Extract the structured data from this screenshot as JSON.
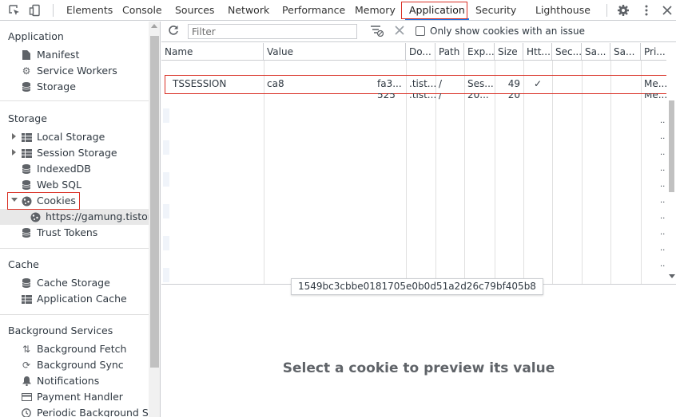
{
  "tabs": [
    "Elements",
    "Console",
    "Sources",
    "Network",
    "Performance",
    "Memory",
    "Application",
    "Security",
    "Lighthouse"
  ],
  "active_tab": "Application",
  "toolbar_icons": {
    "inspect": "inspect-icon",
    "device": "device-toggle-icon",
    "settings": "gear-icon",
    "more": "more-icon",
    "close": "close-icon"
  },
  "sidebar": {
    "application": {
      "title": "Application",
      "items": [
        {
          "label": "Manifest",
          "icon": "document-icon"
        },
        {
          "label": "Service Workers",
          "icon": "gear-icon"
        },
        {
          "label": "Storage",
          "icon": "database-icon"
        }
      ]
    },
    "storage": {
      "title": "Storage",
      "items": [
        {
          "label": "Local Storage",
          "icon": "grid-icon"
        },
        {
          "label": "Session Storage",
          "icon": "grid-icon"
        },
        {
          "label": "IndexedDB",
          "icon": "database-icon"
        },
        {
          "label": "Web SQL",
          "icon": "database-icon"
        },
        {
          "label": "Cookies",
          "icon": "cookie-icon"
        },
        {
          "label": "https://gamung.tistory.c",
          "icon": "cookie-icon"
        },
        {
          "label": "Trust Tokens",
          "icon": "database-icon"
        }
      ]
    },
    "cache": {
      "title": "Cache",
      "items": [
        {
          "label": "Cache Storage",
          "icon": "database-icon"
        },
        {
          "label": "Application Cache",
          "icon": "grid-icon"
        }
      ]
    },
    "background": {
      "title": "Background Services",
      "items": [
        {
          "label": "Background Fetch",
          "icon": "arrows-icon"
        },
        {
          "label": "Background Sync",
          "icon": "sync-icon"
        },
        {
          "label": "Notifications",
          "icon": "bell-icon"
        },
        {
          "label": "Payment Handler",
          "icon": "card-icon"
        },
        {
          "label": "Periodic Background Sync",
          "icon": "clock-icon"
        }
      ]
    }
  },
  "cookie_toolbar": {
    "filter_placeholder": "Filter",
    "only_issue_label": "Only show cookies with an issue"
  },
  "table": {
    "columns": [
      "Name",
      "Value",
      "Do...",
      "Path",
      "Exp...",
      "Size",
      "Htt...",
      "Sec...",
      "Sa...",
      "Sa...",
      "Pri..."
    ],
    "rows": [
      {
        "name": "TSSESSION",
        "value": "ca8",
        "value_tail": "fa3...",
        "domain": ".tist...",
        "path": "/",
        "expires": "Ses...",
        "size": "49",
        "httponly": "✓",
        "secure": "",
        "samesite": "",
        "sameparty": "",
        "priority": "Me..."
      },
      {
        "name": "",
        "value": "",
        "value_tail": "525",
        "domain": ".tist...",
        "path": "/",
        "expires": "20...",
        "size": "20",
        "httponly": "",
        "secure": "",
        "samesite": "",
        "sameparty": "",
        "priority": "Me..."
      }
    ],
    "ellipsis": ".."
  },
  "tooltip": "1549bc3cbbe0181705e0b0d51a2d26c79bf405b8",
  "preview_message": "Select a cookie to preview its value"
}
